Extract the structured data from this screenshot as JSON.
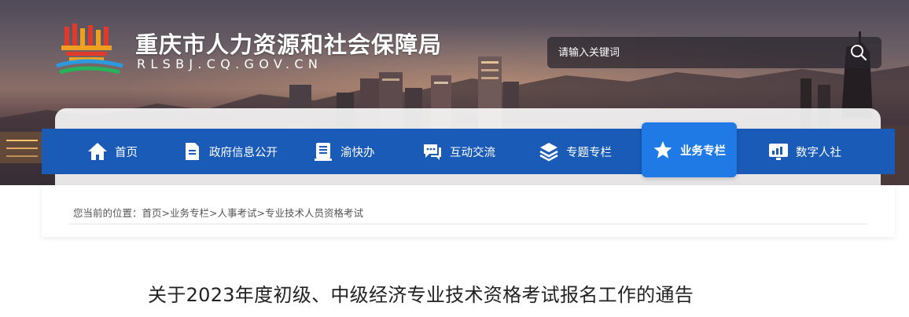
{
  "header": {
    "site_title": "重庆市人力资源和社会保障局",
    "site_domain": "RLSBJ.CQ.GOV.CN",
    "logo_icon": "government-building-logo"
  },
  "search": {
    "placeholder": "请输入关键词",
    "icon": "search-icon"
  },
  "nav": {
    "items": [
      {
        "label": "首页",
        "icon": "home-icon"
      },
      {
        "label": "政府信息公开",
        "icon": "document-icon"
      },
      {
        "label": "渝快办",
        "icon": "book-icon"
      },
      {
        "label": "互动交流",
        "icon": "chat-icon"
      },
      {
        "label": "专题专栏",
        "icon": "layers-icon"
      },
      {
        "label": "业务专栏",
        "icon": "star-icon",
        "active": true
      },
      {
        "label": "数字人社",
        "icon": "monitor-chart-icon"
      }
    ],
    "colors": {
      "bar": "#1b5bb8",
      "active": "#1f7ae6"
    }
  },
  "breadcrumb": {
    "prefix": "您当前的位置：",
    "items": [
      "首页",
      "业务专栏",
      "人事考试",
      "专业技术人员资格考试"
    ],
    "separator": ">"
  },
  "article": {
    "title": "关于2023年度初级、中级经济专业技术资格考试报名工作的通告"
  }
}
